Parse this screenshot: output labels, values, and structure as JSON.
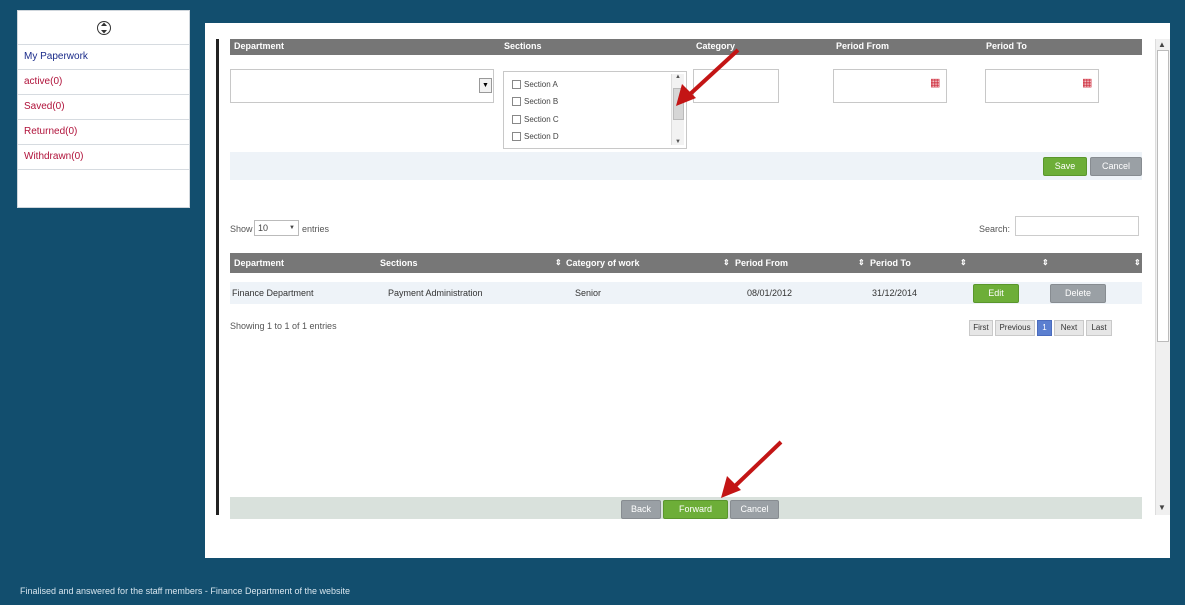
{
  "nav": {
    "items": [
      {
        "label": "My Paperwork"
      },
      {
        "label": "active(0)"
      },
      {
        "label": "Saved(0)"
      },
      {
        "label": "Returned(0)"
      },
      {
        "label": "Withdrawn(0)"
      }
    ]
  },
  "filters": {
    "headers": [
      "Department",
      "Sections",
      "Category",
      "Period From",
      "Period To"
    ],
    "sections_list": [
      "Section A",
      "Section B",
      "Section C",
      "Section D"
    ]
  },
  "actions": {
    "save_label": "Save",
    "cancel_label": "Cancel"
  },
  "table_controls": {
    "show_label": "Show",
    "entries_value": "10",
    "entries_label": "entries",
    "search_label": "Search:",
    "search_placeholder": ""
  },
  "table": {
    "headers": [
      "Department",
      "Sections",
      "Category of work",
      "Period From",
      "Period To",
      "",
      ""
    ],
    "rows": [
      {
        "department": "Finance Department",
        "section": "Payment Administration",
        "category": "Senior",
        "period_from": "08/01/2012",
        "period_to": "31/12/2014",
        "edit_label": "Edit",
        "delete_label": "Delete"
      }
    ]
  },
  "pagination": {
    "info": "Showing 1 to 1 of 1 entries",
    "first": "First",
    "previous": "Previous",
    "current": "1",
    "next": "Next",
    "last": "Last"
  },
  "bottom_actions": {
    "back_label": "Back",
    "forward_label": "Forward",
    "cancel_label": "Cancel"
  },
  "footer": {
    "text": "Finalised and answered for the staff members - Finance Department of the website"
  },
  "colors": {
    "background": "#124e6e",
    "green": "#6dae38",
    "arrow": "#c31515"
  },
  "icons": [
    "up-down-arrows-icon",
    "calendar-icon",
    "sort-icon",
    "annotation-arrow-icon"
  ]
}
